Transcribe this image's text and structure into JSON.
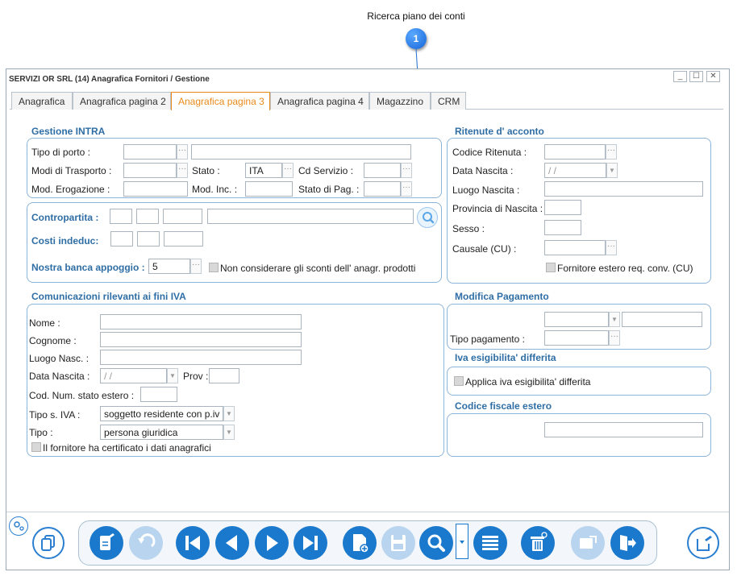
{
  "callout": {
    "label": "Ricerca piano dei conti",
    "number": "1"
  },
  "window": {
    "title": "SERVIZI OR SRL (14) Anagrafica Fornitori / Gestione",
    "controls": {
      "minimize": "_",
      "maximize": "☐",
      "close": "✕"
    }
  },
  "tabs": [
    {
      "label": "Anagrafica"
    },
    {
      "label": "Anagrafica pagina 2"
    },
    {
      "label": "Anagrafica pagina 3",
      "active": true
    },
    {
      "label": "Anagrafica pagina 4"
    },
    {
      "label": "Magazzino"
    },
    {
      "label": "CRM"
    }
  ],
  "intra": {
    "title": "Gestione INTRA",
    "tipo_porto_label": "Tipo di porto :",
    "modi_trasporto_label": "Modi di Trasporto :",
    "stato_label": "Stato :",
    "stato_value": "ITA",
    "cd_servizio_label": "Cd Servizio :",
    "mod_erogazione_label": "Mod. Erogazione :",
    "mod_inc_label": "Mod. Inc. :",
    "stato_pag_label": "Stato di Pag. :"
  },
  "contropartita": {
    "contropartita_label": "Contropartita :",
    "costi_label": "Costi indeduc:",
    "banca_label": "Nostra banca appoggio :",
    "banca_value": "5",
    "sconti_label": "Non considerare gli sconti dell' anagr. prodotti"
  },
  "iva": {
    "title": "Comunicazioni rilevanti ai fini IVA",
    "nome_label": "Nome :",
    "cognome_label": "Cognome :",
    "luogo_label": "Luogo Nasc. :",
    "data_label": "Data Nascita :",
    "data_value": "/ /",
    "prov_label": "Prov :",
    "cod_label": "Cod. Num. stato estero :",
    "tipo_iva_label": "Tipo s. IVA :",
    "tipo_iva_value": "soggetto residente con p.iv",
    "tipo_label": "Tipo :",
    "tipo_value": "persona giuridica",
    "certificato_label": "Il fornitore ha certificato i dati anagrafici"
  },
  "ritenute": {
    "title": "Ritenute d' acconto",
    "codice_label": "Codice Ritenuta :",
    "data_label": "Data Nascita :",
    "data_value": "/ /",
    "luogo_label": "Luogo Nascita :",
    "provincia_label": "Provincia di Nascita :",
    "sesso_label": "Sesso :",
    "causale_label": "Causale (CU) :",
    "estero_label": "Fornitore estero req. conv. (CU)"
  },
  "pagamento": {
    "title": "Modifica Pagamento",
    "tipo_label": "Tipo pagamento :"
  },
  "esigibilita": {
    "title": "Iva esigibilita' differita",
    "applica_label": "Applica iva esigibilita' differita"
  },
  "codfisc": {
    "title": "Codice fiscale estero"
  },
  "colors": {
    "accent": "#1a79cc",
    "section": "#2f6ea5",
    "active_tab": "#e98a1a",
    "panel_border": "#8cb4d8"
  },
  "toolbar_icons": [
    "settings-icon",
    "copy-icon",
    "edit-icon",
    "undo-icon",
    "first-icon",
    "previous-icon",
    "next-icon",
    "last-icon",
    "new-document-icon",
    "save-icon",
    "search-icon",
    "dropdown-icon",
    "list-icon",
    "delete-icon",
    "export-icon",
    "exit-icon",
    "open-icon"
  ]
}
